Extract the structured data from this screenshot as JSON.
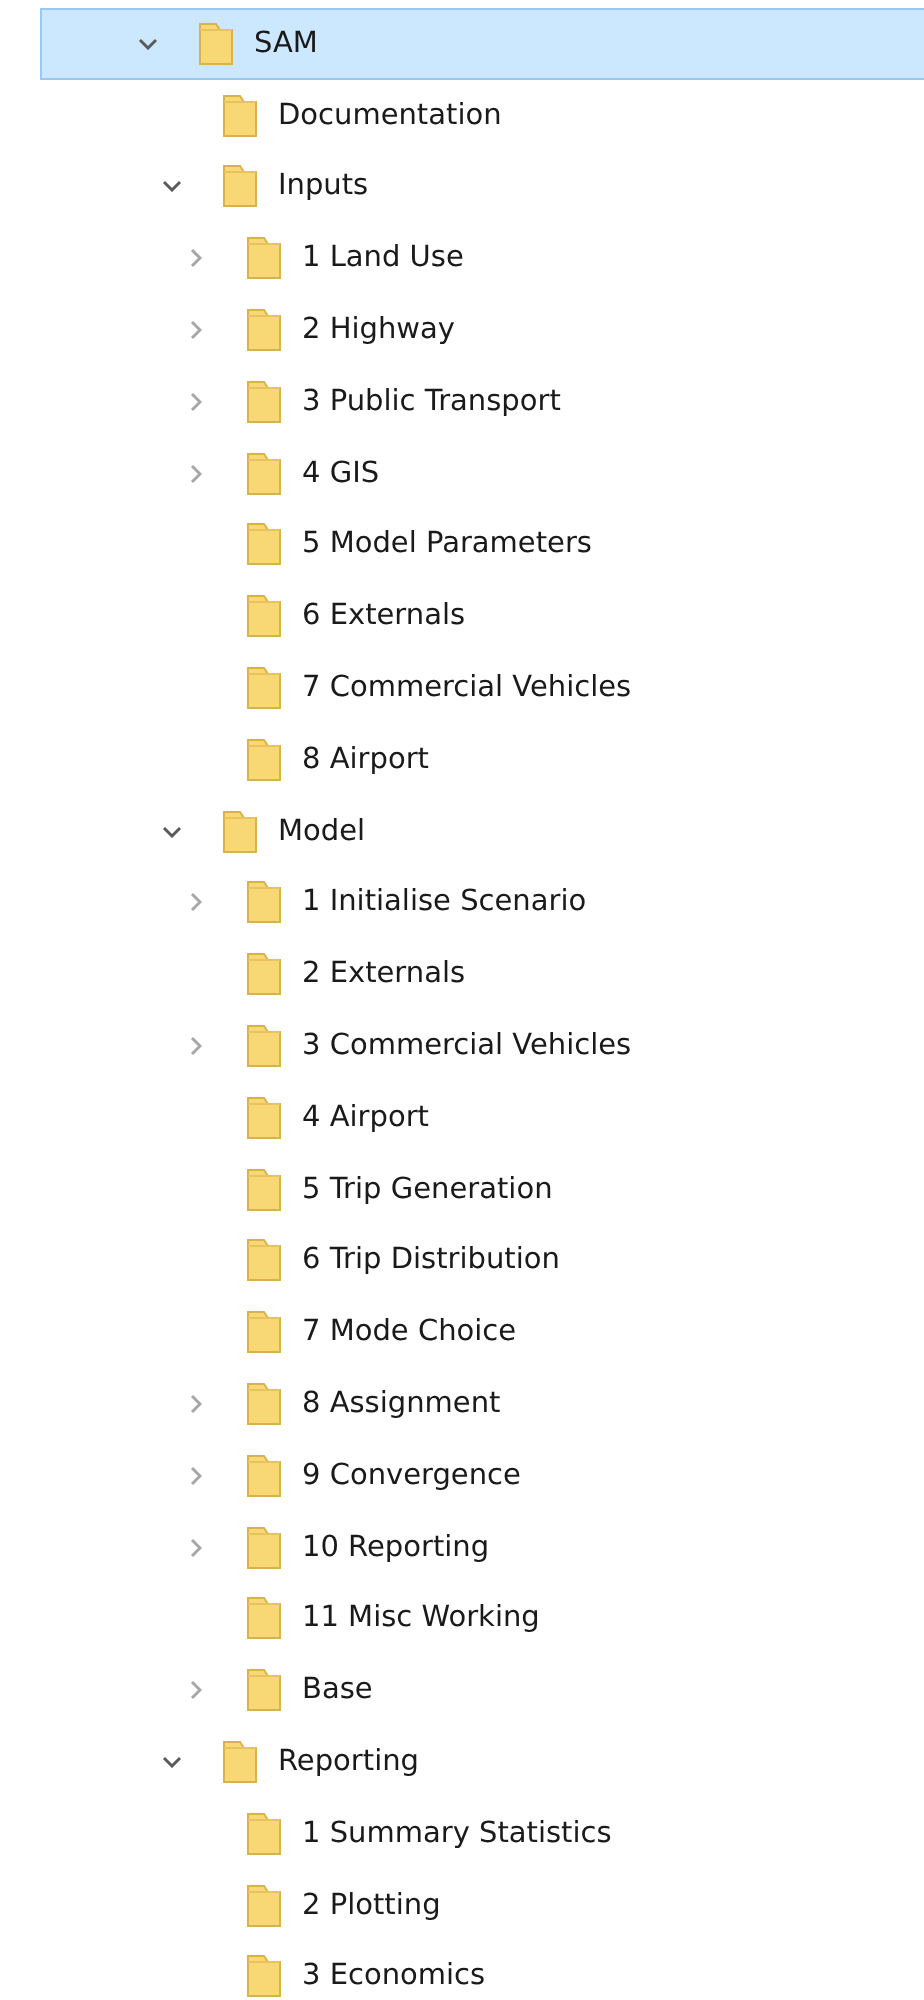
{
  "tree": [
    {
      "label": "SAM",
      "kind": "expanded",
      "selected": true,
      "children": [
        {
          "label": "Documentation",
          "kind": "leaf",
          "selected": false
        },
        {
          "label": "Inputs",
          "kind": "expanded",
          "selected": false,
          "children": [
            {
              "label": "1 Land Use",
              "kind": "collapsed",
              "selected": false
            },
            {
              "label": "2 Highway",
              "kind": "collapsed",
              "selected": false
            },
            {
              "label": "3 Public Transport",
              "kind": "collapsed",
              "selected": false
            },
            {
              "label": "4 GIS",
              "kind": "collapsed",
              "selected": false
            },
            {
              "label": "5 Model Parameters",
              "kind": "leaf",
              "selected": false
            },
            {
              "label": "6 Externals",
              "kind": "leaf",
              "selected": false
            },
            {
              "label": "7 Commercial Vehicles",
              "kind": "leaf",
              "selected": false
            },
            {
              "label": "8 Airport",
              "kind": "leaf",
              "selected": false
            }
          ]
        },
        {
          "label": "Model",
          "kind": "expanded",
          "selected": false,
          "children": [
            {
              "label": "1 Initialise Scenario",
              "kind": "collapsed",
              "selected": false
            },
            {
              "label": "2 Externals",
              "kind": "leaf",
              "selected": false
            },
            {
              "label": "3 Commercial Vehicles",
              "kind": "collapsed",
              "selected": false
            },
            {
              "label": "4 Airport",
              "kind": "leaf",
              "selected": false
            },
            {
              "label": "5 Trip Generation",
              "kind": "leaf",
              "selected": false
            },
            {
              "label": "6 Trip Distribution",
              "kind": "leaf",
              "selected": false
            },
            {
              "label": "7 Mode Choice",
              "kind": "leaf",
              "selected": false
            },
            {
              "label": "8 Assignment",
              "kind": "collapsed",
              "selected": false
            },
            {
              "label": "9 Convergence",
              "kind": "collapsed",
              "selected": false
            },
            {
              "label": "10 Reporting",
              "kind": "collapsed",
              "selected": false
            },
            {
              "label": "11 Misc Working",
              "kind": "leaf",
              "selected": false
            },
            {
              "label": "Base",
              "kind": "collapsed",
              "selected": false
            }
          ]
        },
        {
          "label": "Reporting",
          "kind": "expanded",
          "selected": false,
          "children": [
            {
              "label": "1 Summary Statistics",
              "kind": "leaf",
              "selected": false
            },
            {
              "label": "2 Plotting",
              "kind": "leaf",
              "selected": false
            },
            {
              "label": "3 Economics",
              "kind": "leaf",
              "selected": false
            }
          ]
        }
      ]
    }
  ]
}
